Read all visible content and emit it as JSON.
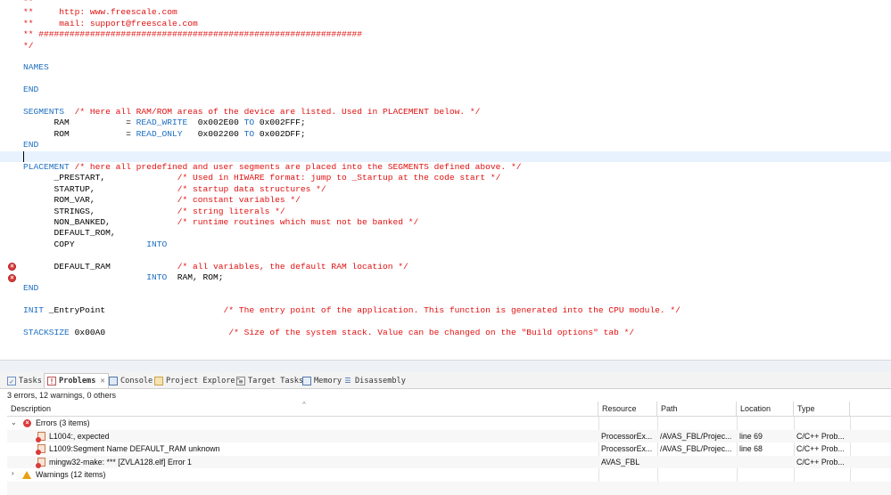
{
  "editor": {
    "lines": [
      [
        {
          "t": "**",
          "c": "com"
        }
      ],
      [
        {
          "t": "**     http: www.freescale.com",
          "c": "com"
        }
      ],
      [
        {
          "t": "**     mail: support@freescale.com",
          "c": "com"
        }
      ],
      [
        {
          "t": "** ###############################################################",
          "c": "com"
        }
      ],
      [
        {
          "t": "*/",
          "c": "com"
        }
      ],
      [],
      [
        {
          "t": "NAMES",
          "c": "kw"
        }
      ],
      [],
      [
        {
          "t": "END",
          "c": "kw"
        }
      ],
      [],
      [
        {
          "t": "SEGMENTS",
          "c": "kw"
        },
        {
          "t": "  /* Here all RAM/ROM areas of the device are listed. Used in PLACEMENT below. */",
          "c": "com"
        }
      ],
      [
        {
          "t": "      RAM           = ",
          "c": "txt"
        },
        {
          "t": "READ_WRITE",
          "c": "kw"
        },
        {
          "t": "  0x002E00 ",
          "c": "txt"
        },
        {
          "t": "TO",
          "c": "kw"
        },
        {
          "t": " 0x002FFF;",
          "c": "txt"
        }
      ],
      [
        {
          "t": "      ROM           = ",
          "c": "txt"
        },
        {
          "t": "READ_ONLY",
          "c": "kw"
        },
        {
          "t": "   0x002200 ",
          "c": "txt"
        },
        {
          "t": "TO",
          "c": "kw"
        },
        {
          "t": " 0x002DFF;",
          "c": "txt"
        }
      ],
      [
        {
          "t": "END",
          "c": "kw"
        }
      ],
      [],
      [
        {
          "t": "PLACEMENT",
          "c": "kw"
        },
        {
          "t": " /* here all predefined and user segments are placed into the SEGMENTS defined above. */",
          "c": "com"
        }
      ],
      [
        {
          "t": "      _PRESTART,              ",
          "c": "txt"
        },
        {
          "t": "/* Used in HIWARE format: jump to _Startup at the code start */",
          "c": "com"
        }
      ],
      [
        {
          "t": "      STARTUP,                ",
          "c": "txt"
        },
        {
          "t": "/* startup data structures */",
          "c": "com"
        }
      ],
      [
        {
          "t": "      ROM_VAR,                ",
          "c": "txt"
        },
        {
          "t": "/* constant variables */",
          "c": "com"
        }
      ],
      [
        {
          "t": "      STRINGS,                ",
          "c": "txt"
        },
        {
          "t": "/* string literals */",
          "c": "com"
        }
      ],
      [
        {
          "t": "      NON_BANKED,             ",
          "c": "txt"
        },
        {
          "t": "/* runtime routines which must not be banked */",
          "c": "com"
        }
      ],
      [
        {
          "t": "      DEFAULT_ROM,",
          "c": "txt"
        }
      ],
      [
        {
          "t": "      COPY              ",
          "c": "txt"
        },
        {
          "t": "INTO",
          "c": "kw"
        }
      ],
      [],
      [
        {
          "t": "      DEFAULT_RAM             ",
          "c": "txt"
        },
        {
          "t": "/* all variables, the default RAM location */",
          "c": "com"
        }
      ],
      [
        {
          "t": "                        ",
          "c": "txt"
        },
        {
          "t": "INTO",
          "c": "kw"
        },
        {
          "t": "  RAM, ROM;",
          "c": "txt"
        }
      ],
      [
        {
          "t": "END",
          "c": "kw"
        }
      ],
      [],
      [
        {
          "t": "INIT",
          "c": "kw"
        },
        {
          "t": " _EntryPoint                       ",
          "c": "txt"
        },
        {
          "t": "/* The entry point of the application. This function is generated into the CPU module. */",
          "c": "com"
        }
      ],
      [],
      [
        {
          "t": "STACKSIZE",
          "c": "kw"
        },
        {
          "t": " 0x00A0                        ",
          "c": "txt"
        },
        {
          "t": "/* Size of the system stack. Value can be changed on the \"Build options\" tab */",
          "c": "com"
        }
      ]
    ],
    "current_line": 14,
    "error_marker_lines": [
      24,
      25
    ],
    "colors": {
      "comment": "#e01010",
      "keyword": "#1e6fc2",
      "text": "#000000",
      "current_line_bg": "#e8f2fe"
    }
  },
  "tabs": [
    {
      "label": "Tasks",
      "icon": "tasks-icon",
      "active": false
    },
    {
      "label": "Problems",
      "icon": "problems-icon",
      "active": true
    },
    {
      "label": "Console",
      "icon": "console-icon",
      "active": false
    },
    {
      "label": "Project Explorer",
      "icon": "project-explorer-icon",
      "active": false
    },
    {
      "label": "Target Tasks",
      "icon": "target-tasks-icon",
      "active": false
    },
    {
      "label": "Memory",
      "icon": "memory-icon",
      "active": false
    },
    {
      "label": "Disassembly",
      "icon": "disassembly-icon",
      "active": false
    }
  ],
  "problems": {
    "summary": "3 errors, 12 warnings, 0 others",
    "columns": [
      "Description",
      "Resource",
      "Path",
      "Location",
      "Type"
    ],
    "groups": [
      {
        "label": "Errors (3 items)",
        "expanded": true,
        "severity": "error",
        "items": [
          {
            "description": "L1004:, expected",
            "resource": "ProcessorEx...",
            "path": "/AVAS_FBL/Projec...",
            "location": "line 69",
            "type": "C/C++ Prob..."
          },
          {
            "description": "L1009:Segment Name DEFAULT_RAM unknown",
            "resource": "ProcessorEx...",
            "path": "/AVAS_FBL/Projec...",
            "location": "line 68",
            "type": "C/C++ Prob..."
          },
          {
            "description": "mingw32-make: *** [ZVLA128.elf] Error 1",
            "resource": "AVAS_FBL",
            "path": "",
            "location": "",
            "type": "C/C++ Prob..."
          }
        ]
      },
      {
        "label": "Warnings (12 items)",
        "expanded": false,
        "severity": "warning",
        "items": []
      }
    ]
  }
}
